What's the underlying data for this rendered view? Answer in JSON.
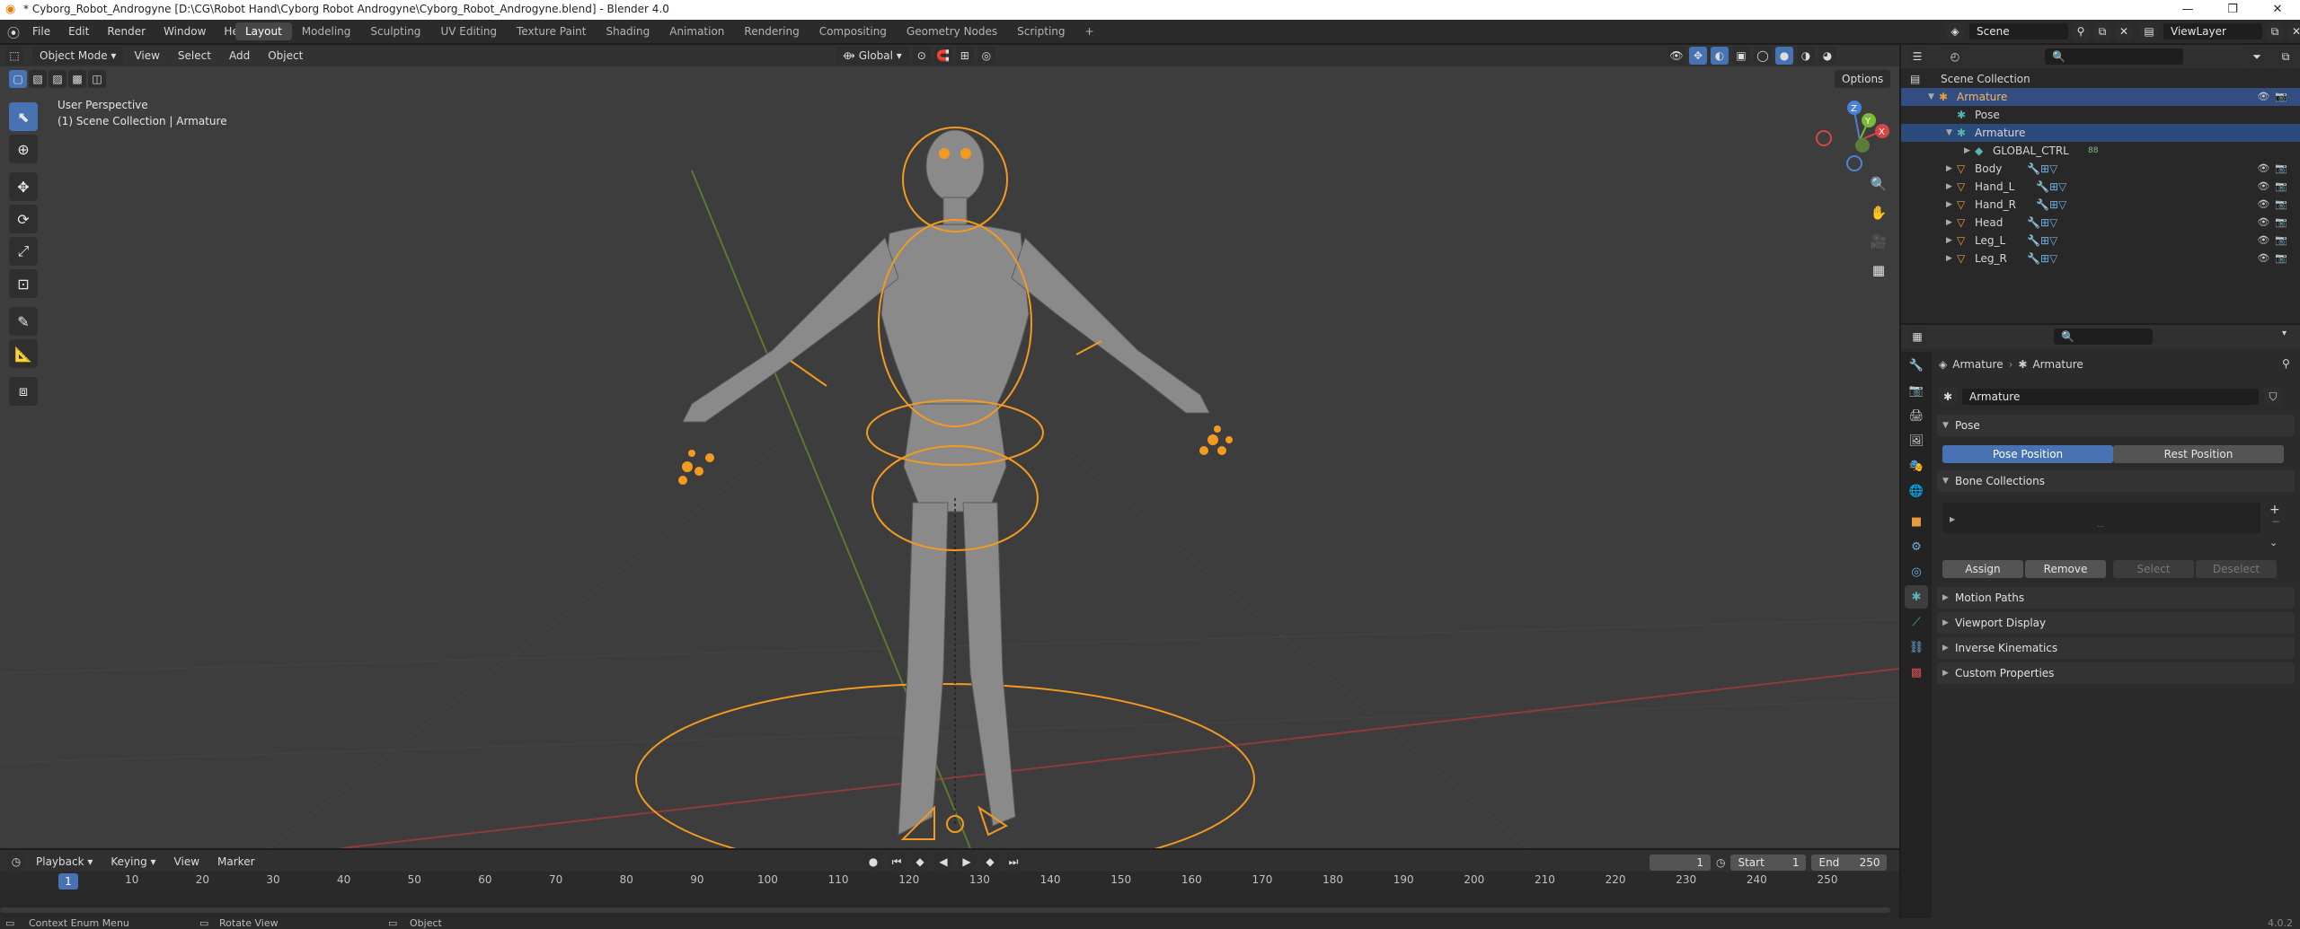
{
  "window": {
    "title": "* Cyborg_Robot_Androgyne [D:\\CG\\Robot Hand\\Cyborg Robot  Androgyne\\Cyborg_Robot_Androgyne.blend] - Blender 4.0",
    "min": "—",
    "max": "❐",
    "close": "✕"
  },
  "menu": {
    "items": [
      "File",
      "Edit",
      "Render",
      "Window",
      "Help"
    ]
  },
  "workspaces": [
    "Layout",
    "Modeling",
    "Sculpting",
    "UV Editing",
    "Texture Paint",
    "Shading",
    "Animation",
    "Rendering",
    "Compositing",
    "Geometry Nodes",
    "Scripting",
    "+"
  ],
  "top_right": {
    "scene": "Scene",
    "view_layer": "ViewLayer"
  },
  "viewport": {
    "mode": "Object Mode",
    "menus": [
      "View",
      "Select",
      "Add",
      "Object"
    ],
    "transform": "Global",
    "options": "Options",
    "overlay_title": "User Perspective",
    "overlay_sub": "(1) Scene Collection | Armature",
    "gizmo": {
      "x": "X",
      "y": "Y",
      "z": "Z"
    }
  },
  "timeline": {
    "menus": [
      "Playback",
      "Keying",
      "View",
      "Marker"
    ],
    "current_frame": "1",
    "frame_field": "1",
    "start_label": "Start",
    "start": "1",
    "end_label": "End",
    "end": "250",
    "ticks": [
      "1",
      "10",
      "20",
      "30",
      "40",
      "50",
      "60",
      "70",
      "80",
      "90",
      "100",
      "110",
      "120",
      "130",
      "140",
      "150",
      "160",
      "170",
      "180",
      "190",
      "200",
      "210",
      "220",
      "230",
      "240",
      "250"
    ]
  },
  "status": {
    "left": "Context Enum Menu",
    "middle": "Rotate View",
    "right": "Object",
    "version": "4.0.2"
  },
  "outliner": {
    "root": "Scene Collection",
    "rows": [
      {
        "label": "Armature"
      },
      {
        "label": "Pose"
      },
      {
        "label": "Armature"
      },
      {
        "label": "GLOBAL_CTRL",
        "badge": "88"
      },
      {
        "label": "Body"
      },
      {
        "label": "Hand_L"
      },
      {
        "label": "Hand_R"
      },
      {
        "label": "Head"
      },
      {
        "label": "Leg_L"
      },
      {
        "label": "Leg_R"
      }
    ]
  },
  "properties": {
    "breadcrumb_a": "Armature",
    "breadcrumb_b": "Armature",
    "data_name": "Armature",
    "pose_panel": "Pose",
    "pose_position": "Pose Position",
    "rest_position": "Rest Position",
    "bone_collections": "Bone Collections",
    "assign": "Assign",
    "remove": "Remove",
    "select": "Select",
    "deselect": "Deselect",
    "motion_paths": "Motion Paths",
    "viewport_display": "Viewport Display",
    "inverse_kinematics": "Inverse Kinematics",
    "custom_properties": "Custom Properties"
  },
  "colors": {
    "accent": "#4772b3",
    "selection_orange": "#f39a21",
    "viewport_bg": "#3d3d3d"
  }
}
